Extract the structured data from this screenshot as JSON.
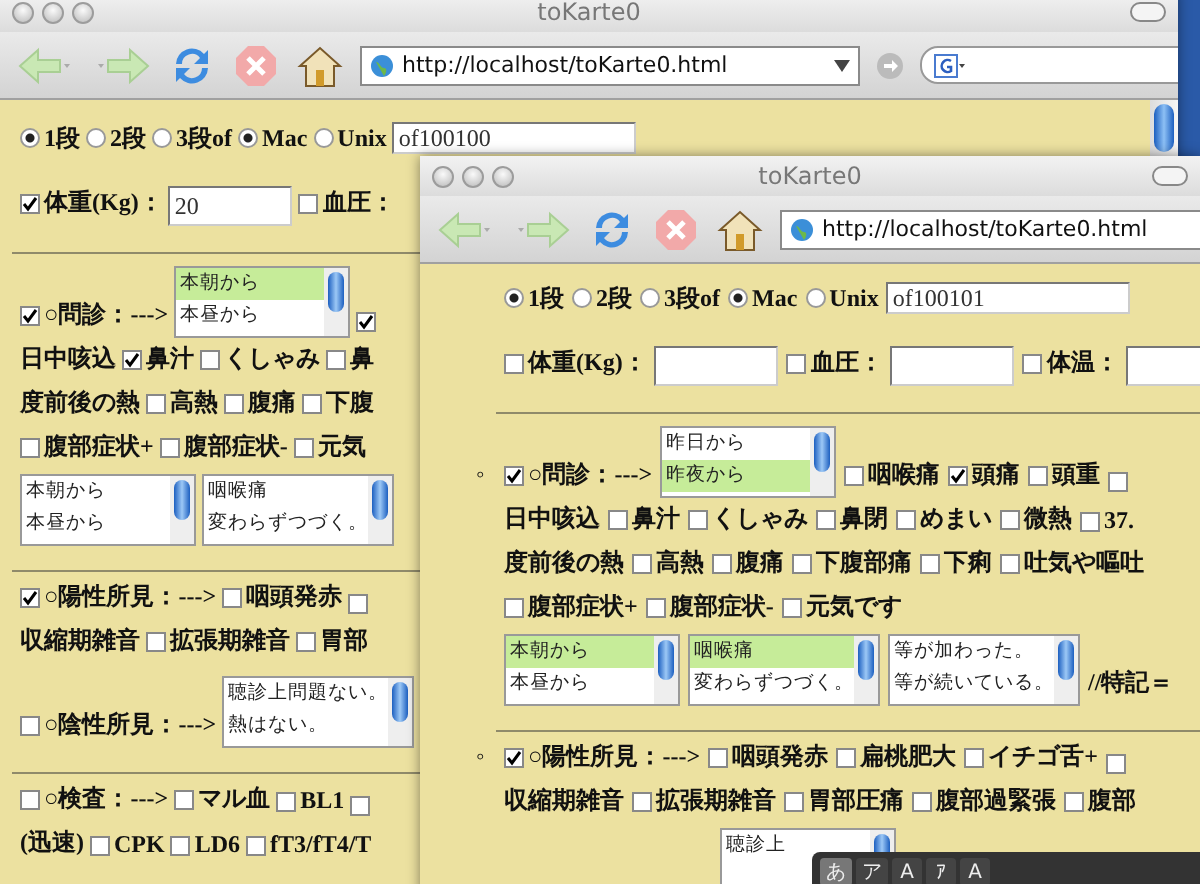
{
  "back_window": {
    "title": "toKarte0",
    "url": "http://localhost/toKarte0.html",
    "lines": [
      {
        "kind": "radios",
        "items": [
          {
            "kind": "radio",
            "label": "1段",
            "selected": true
          },
          {
            "kind": "radio",
            "label": "2段",
            "selected": false
          },
          {
            "kind": "radio",
            "label": "3段of",
            "selected": false
          },
          {
            "kind": "radio",
            "label": "Mac",
            "selected": true
          },
          {
            "kind": "radio",
            "label": "Unix",
            "selected": false
          },
          {
            "kind": "input",
            "value": "of100100"
          }
        ]
      },
      {
        "kind": "fields",
        "items": [
          {
            "kind": "check",
            "label": "体重(Kg)：",
            "checked": true
          },
          {
            "kind": "input",
            "value": "20"
          },
          {
            "kind": "check",
            "label": "血圧：",
            "checked": false
          }
        ]
      },
      {
        "kind": "rule"
      },
      {
        "kind": "row",
        "items": [
          {
            "kind": "check",
            "label": "○問診：--->",
            "checked": true
          },
          {
            "kind": "listbox",
            "options": [
              {
                "label": "本朝から",
                "selected": true
              },
              {
                "label": "本昼から",
                "selected": false
              }
            ]
          },
          {
            "kind": "check",
            "checked": true
          }
        ]
      },
      {
        "kind": "row",
        "items": [
          {
            "kind": "text",
            "text": "日中咳込"
          },
          {
            "kind": "check",
            "label": "鼻汁",
            "checked": true
          },
          {
            "kind": "check",
            "label": "くしゃみ",
            "checked": false
          },
          {
            "kind": "check",
            "label": "鼻",
            "checked": false
          }
        ]
      },
      {
        "kind": "row",
        "items": [
          {
            "kind": "text",
            "text": "度前後の熱"
          },
          {
            "kind": "check",
            "label": "高熱",
            "checked": false
          },
          {
            "kind": "check",
            "label": "腹痛",
            "checked": false
          },
          {
            "kind": "check",
            "label": "下腹",
            "checked": false
          }
        ]
      },
      {
        "kind": "row",
        "items": [
          {
            "kind": "check",
            "label": "腹部症状+",
            "checked": false
          },
          {
            "kind": "check",
            "label": "腹部症状-",
            "checked": false
          },
          {
            "kind": "check",
            "label": "元気",
            "checked": false
          }
        ]
      },
      {
        "kind": "row",
        "items": [
          {
            "kind": "listbox",
            "options": [
              {
                "label": "本朝から",
                "selected": false
              },
              {
                "label": "本昼から",
                "selected": false
              }
            ]
          },
          {
            "kind": "listbox",
            "options": [
              {
                "label": "咽喉痛",
                "selected": false
              },
              {
                "label": "変わらずつづく。",
                "selected": false
              }
            ]
          }
        ]
      },
      {
        "kind": "rule"
      },
      {
        "kind": "row",
        "items": [
          {
            "kind": "check",
            "label": "○陽性所見：--->",
            "checked": true
          },
          {
            "kind": "check",
            "label": "咽頭発赤",
            "checked": false
          },
          {
            "kind": "check",
            "checked": false
          }
        ]
      },
      {
        "kind": "row",
        "items": [
          {
            "kind": "text",
            "text": "収縮期雑音"
          },
          {
            "kind": "check",
            "label": "拡張期雑音",
            "checked": false
          },
          {
            "kind": "check",
            "label": "胃部",
            "checked": false
          }
        ]
      },
      {
        "kind": "row",
        "items": [
          {
            "kind": "check",
            "label": "○陰性所見：--->",
            "checked": false
          },
          {
            "kind": "listbox",
            "options": [
              {
                "label": "聴診上問題ない。",
                "selected": false
              },
              {
                "label": "熱はない。",
                "selected": false
              }
            ]
          }
        ]
      },
      {
        "kind": "rule"
      },
      {
        "kind": "row",
        "items": [
          {
            "kind": "check",
            "label": "○検査：--->",
            "checked": false
          },
          {
            "kind": "check",
            "label": "マル血",
            "checked": false
          },
          {
            "kind": "check",
            "label": "BL1",
            "checked": false
          },
          {
            "kind": "check",
            "checked": false
          }
        ]
      },
      {
        "kind": "row",
        "items": [
          {
            "kind": "text",
            "text": "(迅速)"
          },
          {
            "kind": "check",
            "label": "CPK",
            "checked": false
          },
          {
            "kind": "check",
            "label": "LD6",
            "checked": false
          },
          {
            "kind": "check",
            "label": "fT3/fT4/T",
            "checked": false
          }
        ]
      }
    ]
  },
  "front_window": {
    "title": "toKarte0",
    "url": "http://localhost/toKarte0.html",
    "lines": [
      {
        "kind": "radios",
        "items": [
          {
            "kind": "radio",
            "label": "1段",
            "selected": true
          },
          {
            "kind": "radio",
            "label": "2段",
            "selected": false
          },
          {
            "kind": "radio",
            "label": "3段of",
            "selected": false
          },
          {
            "kind": "radio",
            "label": "Mac",
            "selected": true
          },
          {
            "kind": "radio",
            "label": "Unix",
            "selected": false
          },
          {
            "kind": "input",
            "value": "of100101"
          }
        ]
      },
      {
        "kind": "fields",
        "items": [
          {
            "kind": "check",
            "label": "体重(Kg)：",
            "checked": false
          },
          {
            "kind": "input"
          },
          {
            "kind": "check",
            "label": "血圧：",
            "checked": false
          },
          {
            "kind": "input"
          },
          {
            "kind": "check",
            "label": "体温：",
            "checked": false
          },
          {
            "kind": "input"
          }
        ]
      },
      {
        "kind": "rule"
      },
      {
        "kind": "row",
        "bullet": "◦",
        "items": [
          {
            "kind": "check",
            "label": "○問診：--->",
            "checked": true
          },
          {
            "kind": "listbox",
            "options": [
              {
                "label": "昨日から",
                "selected": false
              },
              {
                "label": "昨夜から",
                "selected": true
              }
            ]
          },
          {
            "kind": "check",
            "label": "咽喉痛",
            "checked": false
          },
          {
            "kind": "check",
            "label": "頭痛",
            "checked": true
          },
          {
            "kind": "check",
            "label": "頭重",
            "checked": false
          },
          {
            "kind": "check",
            "checked": false
          }
        ]
      },
      {
        "kind": "row",
        "items": [
          {
            "kind": "text",
            "text": "日中咳込"
          },
          {
            "kind": "check",
            "label": "鼻汁",
            "checked": false
          },
          {
            "kind": "check",
            "label": "くしゃみ",
            "checked": false
          },
          {
            "kind": "check",
            "label": "鼻閉",
            "checked": false
          },
          {
            "kind": "check",
            "label": "めまい",
            "checked": false
          },
          {
            "kind": "check",
            "label": "微熱",
            "checked": false
          },
          {
            "kind": "check",
            "label": "37.",
            "checked": false
          }
        ]
      },
      {
        "kind": "row",
        "items": [
          {
            "kind": "text",
            "text": "度前後の熱"
          },
          {
            "kind": "check",
            "label": "高熱",
            "checked": false
          },
          {
            "kind": "check",
            "label": "腹痛",
            "checked": false
          },
          {
            "kind": "check",
            "label": "下腹部痛",
            "checked": false
          },
          {
            "kind": "check",
            "label": "下痢",
            "checked": false
          },
          {
            "kind": "check",
            "label": "吐気や嘔吐",
            "checked": false
          }
        ]
      },
      {
        "kind": "row",
        "items": [
          {
            "kind": "check",
            "label": "腹部症状+",
            "checked": false
          },
          {
            "kind": "check",
            "label": "腹部症状-",
            "checked": false
          },
          {
            "kind": "check",
            "label": "元気です",
            "checked": false
          }
        ]
      },
      {
        "kind": "row",
        "items": [
          {
            "kind": "listbox",
            "options": [
              {
                "label": "本朝から",
                "selected": true
              },
              {
                "label": "本昼から",
                "selected": false
              }
            ]
          },
          {
            "kind": "listbox",
            "options": [
              {
                "label": "咽喉痛",
                "selected": true
              },
              {
                "label": "変わらずつづく。",
                "selected": false
              }
            ]
          },
          {
            "kind": "listbox",
            "options": [
              {
                "label": "等が加わった。",
                "selected": false
              },
              {
                "label": "等が続いている。",
                "selected": false
              }
            ]
          },
          {
            "kind": "text",
            "text": "//特記＝"
          }
        ]
      },
      {
        "kind": "rule"
      },
      {
        "kind": "row",
        "bullet": "◦",
        "items": [
          {
            "kind": "check",
            "label": "○陽性所見：--->",
            "checked": true
          },
          {
            "kind": "check",
            "label": "咽頭発赤",
            "checked": false
          },
          {
            "kind": "check",
            "label": "扁桃肥大",
            "checked": false
          },
          {
            "kind": "check",
            "label": "イチゴ舌+",
            "checked": false
          },
          {
            "kind": "check",
            "checked": false
          }
        ]
      },
      {
        "kind": "row",
        "items": [
          {
            "kind": "text",
            "text": "収縮期雑音"
          },
          {
            "kind": "check",
            "label": "拡張期雑音",
            "checked": false
          },
          {
            "kind": "check",
            "label": "胃部圧痛",
            "checked": false
          },
          {
            "kind": "check",
            "label": "腹部過緊張",
            "checked": false
          },
          {
            "kind": "check",
            "label": "腹部",
            "checked": false
          }
        ]
      },
      {
        "kind": "indented",
        "items": [
          {
            "kind": "listbox",
            "options": [
              {
                "label": "聴診上",
                "selected": false
              }
            ]
          }
        ]
      }
    ]
  },
  "ime_palette": {
    "keys": [
      {
        "label": "あ",
        "selected": true
      },
      {
        "label": "ア",
        "selected": false
      },
      {
        "label": "A",
        "selected": false
      },
      {
        "label": "ｱ",
        "selected": false
      },
      {
        "label": "A",
        "selected": false
      }
    ]
  }
}
